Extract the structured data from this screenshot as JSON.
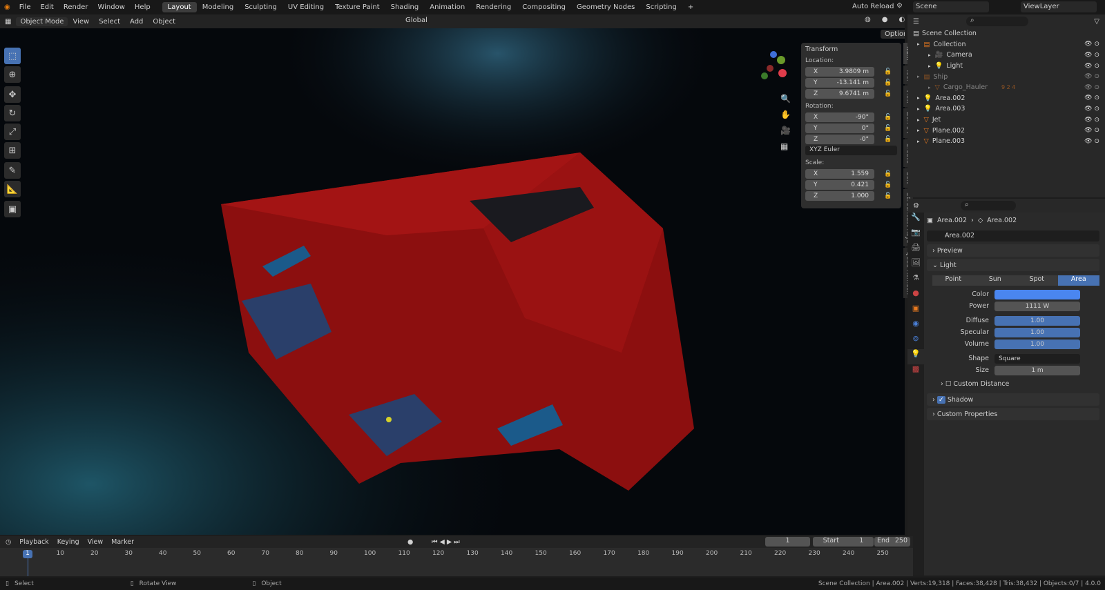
{
  "topbar": {
    "menus": [
      "File",
      "Edit",
      "Render",
      "Window",
      "Help"
    ],
    "workspaces": [
      "Layout",
      "Modeling",
      "Sculpting",
      "UV Editing",
      "Texture Paint",
      "Shading",
      "Animation",
      "Rendering",
      "Compositing",
      "Geometry Nodes",
      "Scripting"
    ],
    "active_workspace": "Layout",
    "add": "+",
    "auto_reload": "Auto Reload",
    "scene": "Scene",
    "view_layer": "ViewLayer"
  },
  "viewport_header": {
    "mode": "Object Mode",
    "menus": [
      "View",
      "Select",
      "Add",
      "Object"
    ],
    "orientation": "Global",
    "options": "Options"
  },
  "npanel": {
    "title": "Transform",
    "location_label": "Location:",
    "location": [
      {
        "axis": "X",
        "value": "3.9809 m"
      },
      {
        "axis": "Y",
        "value": "-13.141 m"
      },
      {
        "axis": "Z",
        "value": "9.6741 m"
      }
    ],
    "rotation_label": "Rotation:",
    "rotation": [
      {
        "axis": "X",
        "value": "-90°"
      },
      {
        "axis": "Y",
        "value": "0°"
      },
      {
        "axis": "Z",
        "value": "-0°"
      }
    ],
    "rotation_mode": "XYZ Euler",
    "scale_label": "Scale:",
    "scale": [
      {
        "axis": "X",
        "value": "1.559"
      },
      {
        "axis": "Y",
        "value": "0.421"
      },
      {
        "axis": "Z",
        "value": "1.000"
      }
    ]
  },
  "sidebar_tabs": [
    "Item",
    "Tool",
    "View",
    "Zen UV",
    "Create",
    "Edit",
    "Screencast Keys",
    "Quad Remesh"
  ],
  "outliner": {
    "root": "Scene Collection",
    "items": [
      {
        "name": "Collection",
        "depth": 0
      },
      {
        "name": "Camera",
        "depth": 1
      },
      {
        "name": "Light",
        "depth": 1
      },
      {
        "name": "Ship",
        "depth": 0,
        "dim": true
      },
      {
        "name": "Cargo_Hauler",
        "depth": 1,
        "dim": true,
        "badges": "9 2 4"
      },
      {
        "name": "Area.002",
        "depth": 0
      },
      {
        "name": "Area.003",
        "depth": 0
      },
      {
        "name": "Jet",
        "depth": 0
      },
      {
        "name": "Plane.002",
        "depth": 0
      },
      {
        "name": "Plane.003",
        "depth": 0
      }
    ]
  },
  "properties": {
    "breadcrumb": [
      "Area.002",
      "Area.002"
    ],
    "datablock": "Area.002",
    "preview": "Preview",
    "light": "Light",
    "light_types": [
      "Point",
      "Sun",
      "Spot",
      "Area"
    ],
    "active_type": "Area",
    "color_label": "Color",
    "color": "#4a86f0",
    "power_label": "Power",
    "power": "1111 W",
    "diffuse_label": "Diffuse",
    "diffuse": "1.00",
    "specular_label": "Specular",
    "specular": "1.00",
    "volume_label": "Volume",
    "volume": "1.00",
    "shape_label": "Shape",
    "shape": "Square",
    "size_label": "Size",
    "size": "1 m",
    "custom_distance": "Custom Distance",
    "shadow": "Shadow",
    "custom_properties": "Custom Properties"
  },
  "timeline": {
    "menus": [
      "Playback",
      "Keying",
      "View",
      "Marker"
    ],
    "current_frame": "1",
    "start_label": "Start",
    "start": "1",
    "end_label": "End",
    "end": "250",
    "ticks": [
      "10",
      "20",
      "30",
      "40",
      "50",
      "60",
      "70",
      "80",
      "90",
      "100",
      "110",
      "120",
      "130",
      "140",
      "150",
      "160",
      "170",
      "180",
      "190",
      "200",
      "210",
      "220",
      "230",
      "240",
      "250"
    ],
    "playhead": "1"
  },
  "status": {
    "select": "Select",
    "rotate": "Rotate View",
    "object": "Object",
    "stats": "Scene Collection | Area.002 | Verts:19,318 | Faces:38,428 | Tris:38,432 | Objects:0/7 | 4.0.0"
  }
}
